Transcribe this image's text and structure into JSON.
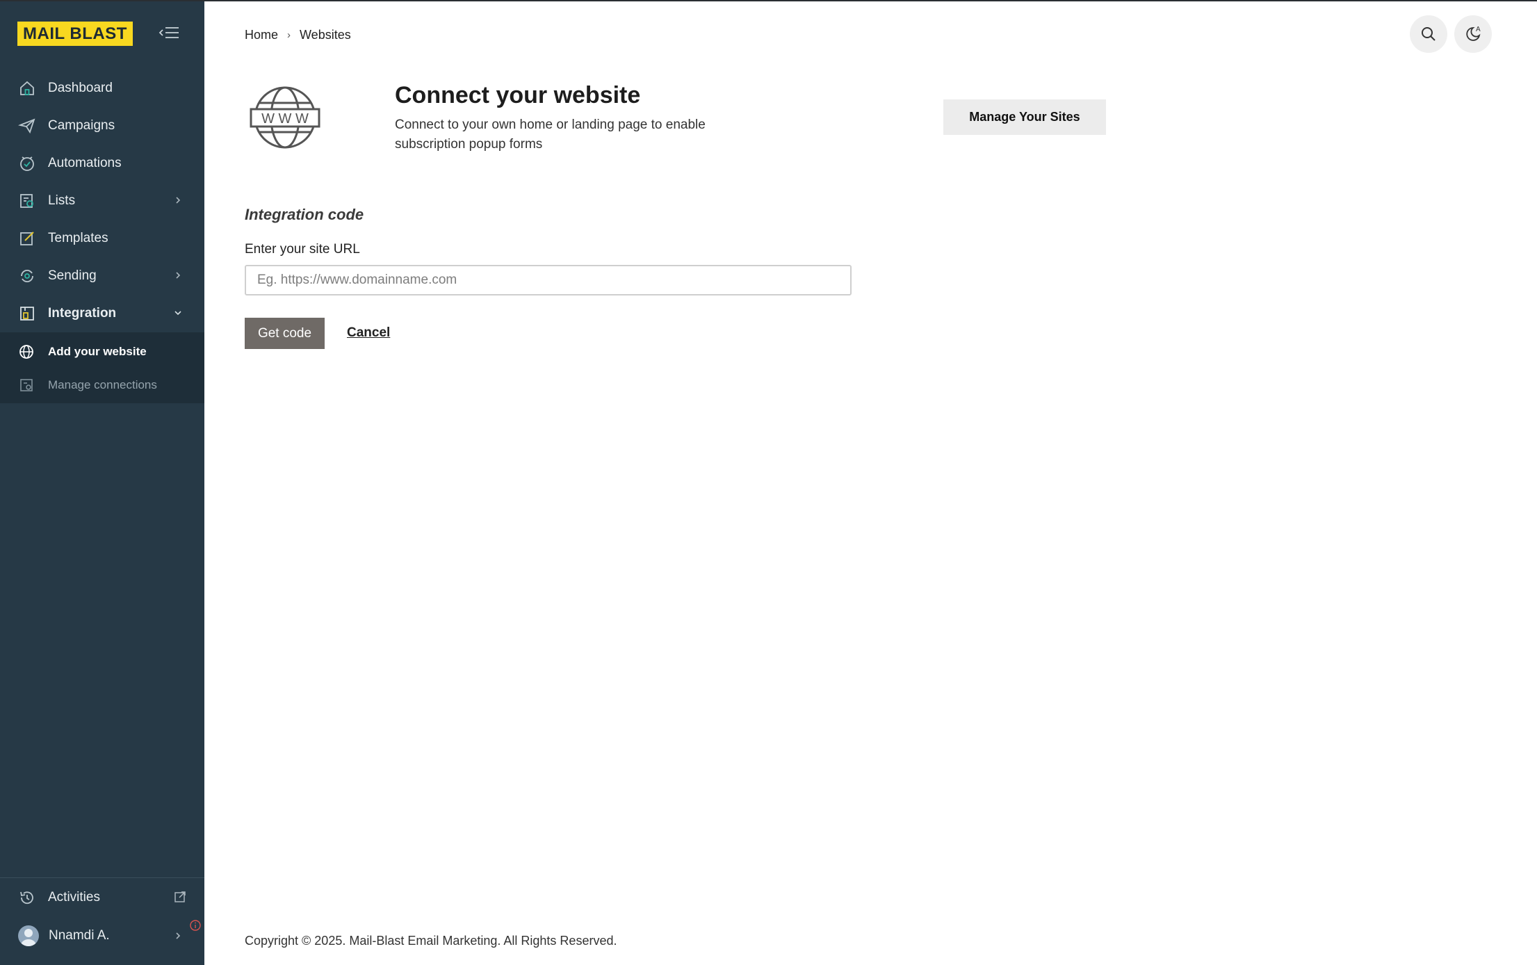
{
  "app": {
    "logo_text": "MAIL BLAST",
    "colors": {
      "sidebar_bg": "#263946",
      "logo_bg": "#f8d820",
      "button_bg": "#6f6a66"
    }
  },
  "sidebar": {
    "items": [
      {
        "label": "Dashboard",
        "icon": "home-icon"
      },
      {
        "label": "Campaigns",
        "icon": "send-icon"
      },
      {
        "label": "Automations",
        "icon": "automation-icon"
      },
      {
        "label": "Lists",
        "icon": "list-icon"
      },
      {
        "label": "Templates",
        "icon": "template-icon"
      },
      {
        "label": "Sending",
        "icon": "sending-icon"
      },
      {
        "label": "Integration",
        "icon": "integration-icon"
      }
    ],
    "subitems": [
      {
        "label": "Add your website",
        "icon": "globe-icon"
      },
      {
        "label": "Manage connections",
        "icon": "connections-icon"
      }
    ],
    "bottom": {
      "activities": "Activities",
      "user_name": "Nnamdi A."
    }
  },
  "breadcrumb": {
    "home": "Home",
    "sep": "›",
    "current": "Websites"
  },
  "hero": {
    "title": "Connect your website",
    "subtitle": "Connect to your own home or landing page to enable subscription popup forms",
    "manage_button": "Manage Your Sites",
    "globe_text": "W W W"
  },
  "form": {
    "section_title": "Integration code",
    "url_label": "Enter your site URL",
    "url_placeholder": "Eg. https://www.domainname.com",
    "url_value": "",
    "submit_label": "Get code",
    "cancel_label": "Cancel"
  },
  "footer": {
    "copyright": "Copyright © 2025. Mail-Blast Email Marketing. All Rights Reserved."
  }
}
